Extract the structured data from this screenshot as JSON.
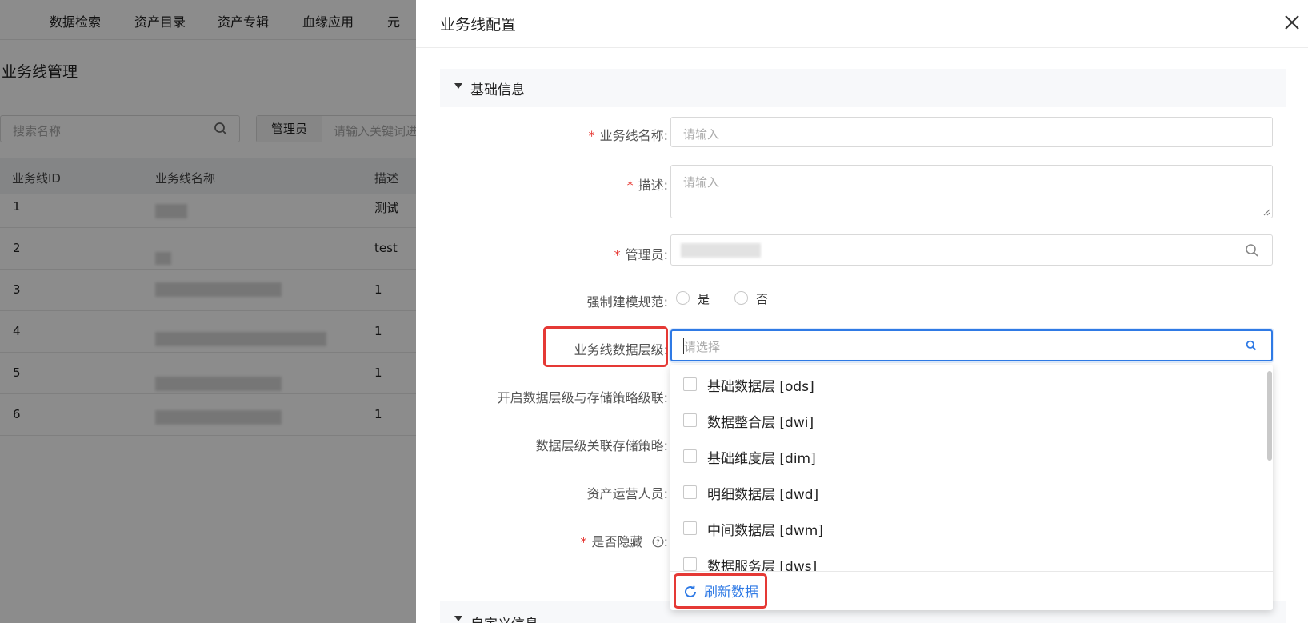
{
  "background": {
    "nav": [
      "数据检索",
      "资产目录",
      "资产专辑",
      "血缘应用",
      "元"
    ],
    "page_title": "业务线管理",
    "search_placeholder": "搜索名称",
    "filter_label": "管理员",
    "filter_placeholder": "请输入关键词进",
    "table": {
      "headers": [
        "业务线ID",
        "业务线名称",
        "描述"
      ],
      "rows": [
        {
          "id": "1",
          "desc": "测试"
        },
        {
          "id": "2",
          "desc": "test"
        },
        {
          "id": "3",
          "desc": "1"
        },
        {
          "id": "4",
          "desc": "1"
        },
        {
          "id": "5",
          "desc": "1"
        },
        {
          "id": "6",
          "desc": "1"
        }
      ]
    }
  },
  "drawer": {
    "title": "业务线配置",
    "section_basic": "基础信息",
    "section_custom": "自定义信息",
    "fields": {
      "name_label": "业务线名称:",
      "name_placeholder": "请输入",
      "desc_label": "描述:",
      "desc_placeholder": "请输入",
      "admin_label": "管理员:",
      "force_label": "强制建模规范:",
      "force_yes": "是",
      "force_no": "否",
      "layer_label": "业务线数据层级:",
      "layer_placeholder": "请选择",
      "cascade_label": "开启数据层级与存储策略级联:",
      "storage_label": "数据层级关联存储策略:",
      "operator_label": "资产运营人员:",
      "hidden_label": "是否隐藏",
      "hidden_suffix": ":"
    },
    "dropdown": {
      "options": [
        "基础数据层 [ods]",
        "数据整合层 [dwi]",
        "基础维度层 [dim]",
        "明细数据层 [dwd]",
        "中间数据层 [dwm]",
        "数据服务层 [dws]"
      ],
      "refresh_label": "刷新数据"
    }
  }
}
